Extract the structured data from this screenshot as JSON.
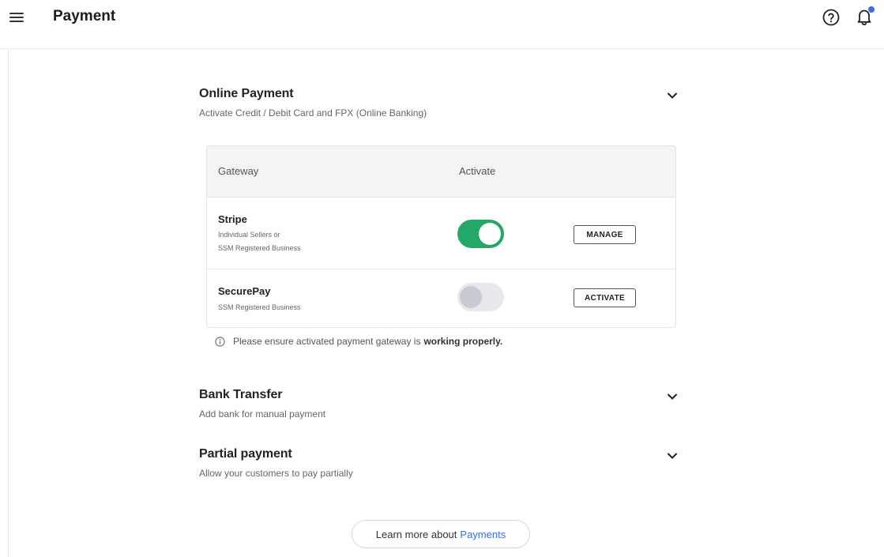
{
  "header": {
    "title": "Payment",
    "icons": [
      "menu-icon",
      "help-circle-icon",
      "bell-icon"
    ],
    "notification_dot_color": "#3b6bf0"
  },
  "online_payment": {
    "title": "Online Payment",
    "subtitle": "Activate Credit / Debit Card and FPX (Online Banking)",
    "table": {
      "columns": [
        "Gateway",
        "Activate"
      ],
      "rows": [
        {
          "name": "Stripe",
          "desc_line1": "Individual Sellers or",
          "desc_line2": "SSM Registered Business",
          "active": true,
          "action": "MANAGE"
        },
        {
          "name": "SecurePay",
          "desc_line1": "SSM Registered Business",
          "active": false,
          "action": "ACTIVATE"
        }
      ]
    },
    "notice_prefix": "Please ensure activated payment gateway is",
    "notice_bold": "working properly."
  },
  "bank_transfer": {
    "title": "Bank Transfer",
    "subtitle": "Add bank for manual payment"
  },
  "partial_payment": {
    "title": "Partial payment",
    "subtitle": "Allow your customers to pay partially"
  },
  "learn_more": {
    "prefix": "Learn more about",
    "link": "Payments"
  },
  "colors": {
    "toggle_on": "#22a968",
    "toggle_off": "#e8e8ec",
    "link": "#3a6fe0"
  }
}
